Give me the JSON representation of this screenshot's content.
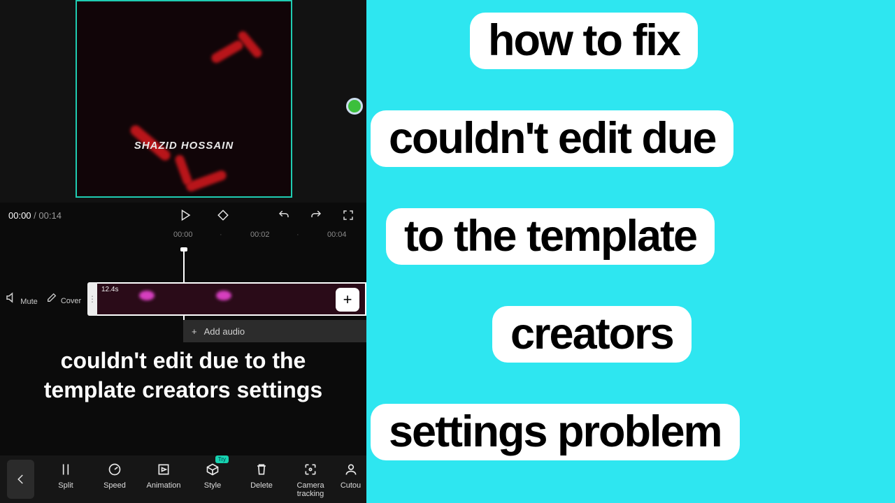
{
  "preview": {
    "watermark": "SHAZID HOSSAIN"
  },
  "playbar": {
    "current": "00:00",
    "sep": " / ",
    "total": "00:14"
  },
  "ruler": {
    "t0": "00:00",
    "t1": "00:02",
    "t2": "00:04"
  },
  "track": {
    "mute_label": "Mute",
    "cover_label": "Cover",
    "clip_duration": "12.4s",
    "add_audio": "Add audio"
  },
  "overlay_text": "couldn't edit due to the template creators settings",
  "toolbar": {
    "split": "Split",
    "speed": "Speed",
    "animation": "Animation",
    "style": "Style",
    "style_tip": "Try",
    "delete": "Delete",
    "camera": "Camera tracking",
    "cutout": "Cutou"
  },
  "thumb": {
    "l1": "how to fix",
    "l2": "couldn't edit due",
    "l3": "to the template",
    "l4": "creators",
    "l5": "settings problem"
  }
}
